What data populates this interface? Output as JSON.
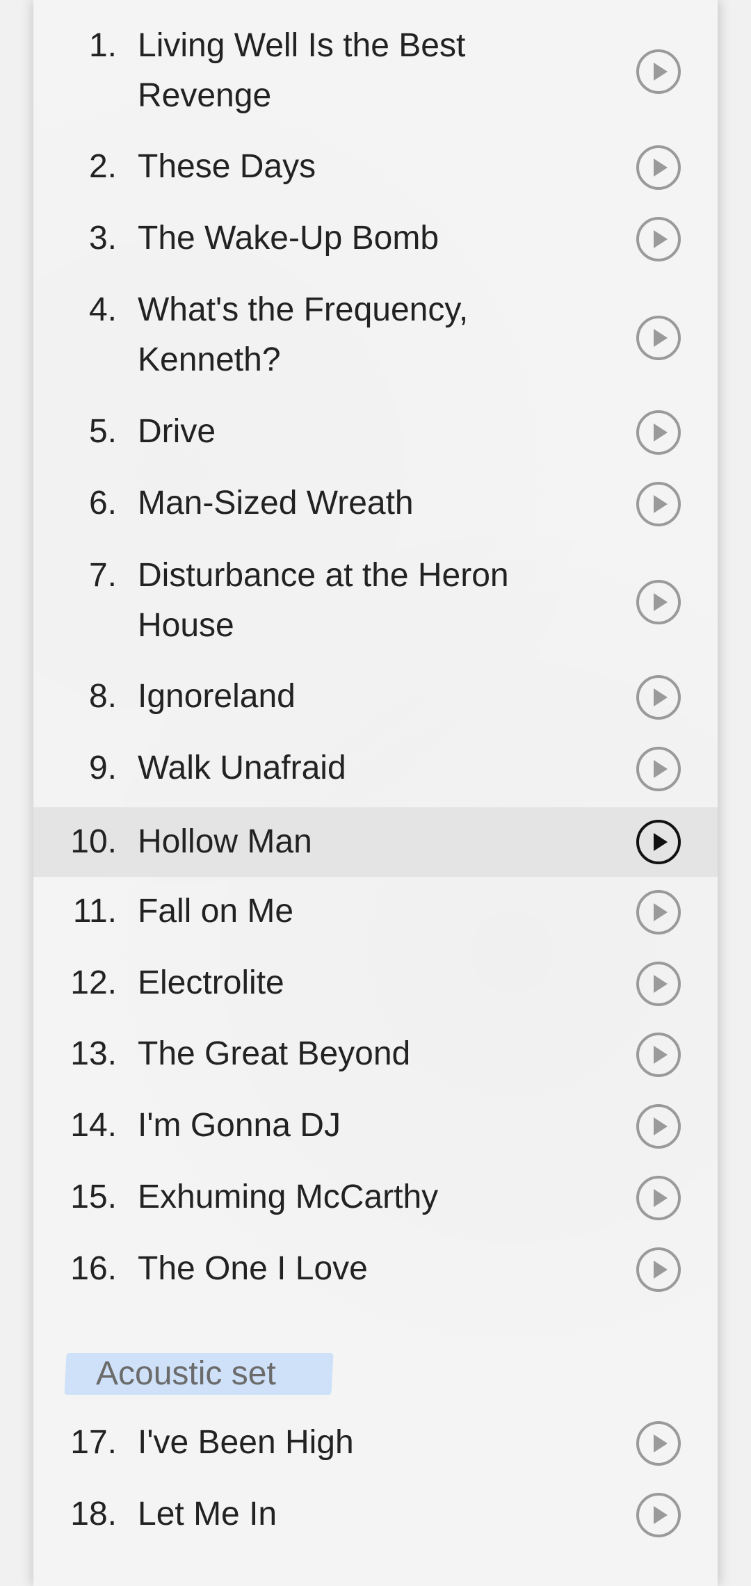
{
  "tracks": [
    {
      "number": "1.",
      "title": "Living Well Is the Best Revenge"
    },
    {
      "number": "2.",
      "title": "These Days"
    },
    {
      "number": "3.",
      "title": "The Wake-Up Bomb"
    },
    {
      "number": "4.",
      "title": "What's the Frequency, Kenneth?"
    },
    {
      "number": "5.",
      "title": "Drive"
    },
    {
      "number": "6.",
      "title": "Man-Sized Wreath"
    },
    {
      "number": "7.",
      "title": "Disturbance at the Heron House"
    },
    {
      "number": "8.",
      "title": "Ignoreland"
    },
    {
      "number": "9.",
      "title": "Walk Unafraid"
    },
    {
      "number": "10.",
      "title": "Hollow Man"
    },
    {
      "number": "11.",
      "title": "Fall on Me"
    },
    {
      "number": "12.",
      "title": "Electrolite"
    },
    {
      "number": "13.",
      "title": "The Great Beyond"
    },
    {
      "number": "14.",
      "title": "I'm Gonna DJ"
    },
    {
      "number": "15.",
      "title": "Exhuming McCarthy"
    },
    {
      "number": "16.",
      "title": "The One I Love"
    },
    {
      "number": "17.",
      "title": "I've Been High"
    },
    {
      "number": "18.",
      "title": "Let Me In"
    }
  ],
  "section": {
    "label": "Acoustic set"
  },
  "icons": {
    "play": "play-circle-icon"
  },
  "colors": {
    "active_row": "#e4e4e4",
    "section_highlight": "#cfe1f8",
    "play_idle": "#9a9a9a",
    "play_active": "#111111"
  },
  "active_track_index": 9
}
